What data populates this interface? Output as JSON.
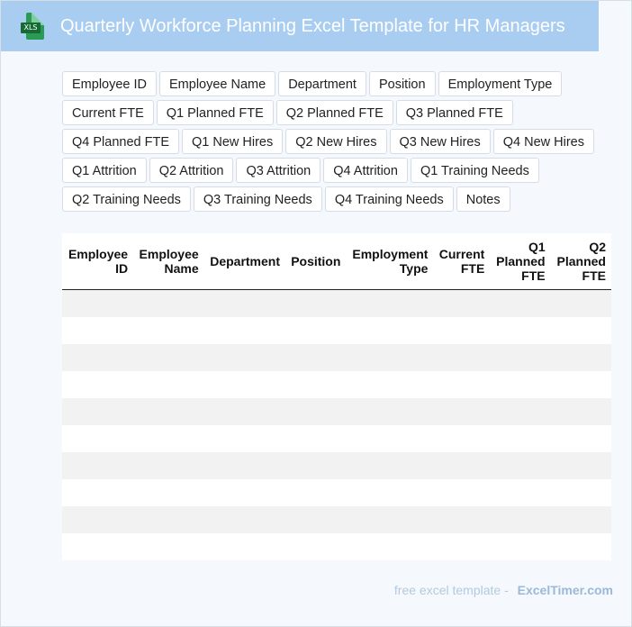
{
  "header": {
    "title": "Quarterly Workforce Planning Excel Template for HR Managers",
    "icon": "xls-file-icon",
    "icon_label": "XLS",
    "background": "#a8cdf0"
  },
  "fields": [
    "Employee ID",
    "Employee Name",
    "Department",
    "Position",
    "Employment Type",
    "Current FTE",
    "Q1 Planned FTE",
    "Q2 Planned FTE",
    "Q3 Planned FTE",
    "Q4 Planned FTE",
    "Q1 New Hires",
    "Q2 New Hires",
    "Q3 New Hires",
    "Q4 New Hires",
    "Q1 Attrition",
    "Q2 Attrition",
    "Q3 Attrition",
    "Q4 Attrition",
    "Q1 Training Needs",
    "Q2 Training Needs",
    "Q3 Training Needs",
    "Q4 Training Needs",
    "Notes"
  ],
  "table": {
    "columns": [
      "Employee ID",
      "Employee Name",
      "Department",
      "Position",
      "Employment Type",
      "Current FTE",
      "Q1 Planned FTE",
      "Q2 Planned FTE"
    ],
    "empty_rows": 10
  },
  "footer": {
    "prefix": "free excel template -",
    "brand": "ExcelTimer.com"
  }
}
